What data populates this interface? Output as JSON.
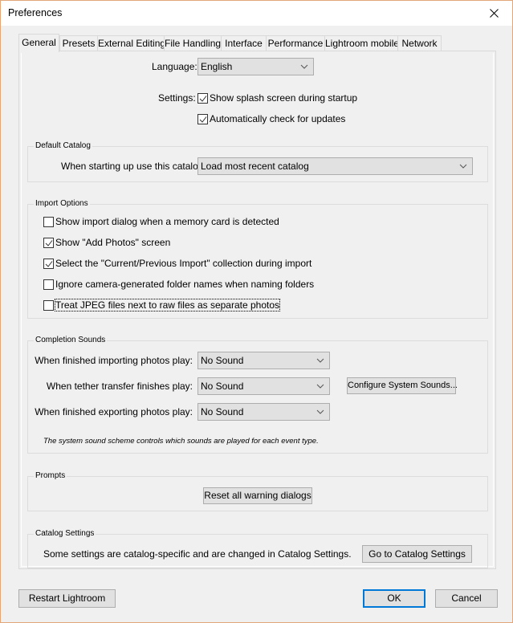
{
  "window": {
    "title": "Preferences",
    "close_icon": "close-icon"
  },
  "tabs": [
    {
      "label": "General",
      "active": true
    },
    {
      "label": "Presets",
      "active": false
    },
    {
      "label": "External Editing",
      "active": false
    },
    {
      "label": "File Handling",
      "active": false
    },
    {
      "label": "Interface",
      "active": false
    },
    {
      "label": "Performance",
      "active": false
    },
    {
      "label": "Lightroom mobile",
      "active": false
    },
    {
      "label": "Network",
      "active": false
    }
  ],
  "general": {
    "language_label": "Language:",
    "language_value": "English",
    "settings_label": "Settings:",
    "settings_options": [
      {
        "label": "Show splash screen during startup",
        "checked": true
      },
      {
        "label": "Automatically check for updates",
        "checked": true
      }
    ]
  },
  "default_catalog": {
    "title": "Default Catalog",
    "label": "When starting up use this catalog:",
    "value": "Load most recent catalog"
  },
  "import_options": {
    "title": "Import Options",
    "items": [
      {
        "label": "Show import dialog when a memory card is detected",
        "checked": false
      },
      {
        "label": "Show \"Add Photos\" screen",
        "checked": true
      },
      {
        "label": "Select the \"Current/Previous Import\" collection during import",
        "checked": true
      },
      {
        "label": "Ignore camera-generated folder names when naming folders",
        "checked": false
      },
      {
        "label": "Treat JPEG files next to raw files as separate photos",
        "checked": false,
        "focused": true
      }
    ]
  },
  "completion_sounds": {
    "title": "Completion Sounds",
    "rows": [
      {
        "label": "When finished importing photos play:",
        "value": "No Sound"
      },
      {
        "label": "When tether transfer finishes play:",
        "value": "No Sound"
      },
      {
        "label": "When finished exporting photos play:",
        "value": "No Sound"
      }
    ],
    "configure_button": "Configure System Sounds...",
    "note": "The system sound scheme controls which sounds are played for each event type."
  },
  "prompts": {
    "title": "Prompts",
    "reset_button": "Reset all warning dialogs"
  },
  "catalog_settings": {
    "title": "Catalog Settings",
    "text": "Some settings are catalog-specific and are changed in Catalog Settings.",
    "button": "Go to Catalog Settings"
  },
  "footer": {
    "restart_button": "Restart Lightroom",
    "ok_button": "OK",
    "cancel_button": "Cancel"
  },
  "colors": {
    "accent": "#0078d7",
    "window_border": "#e2a67b",
    "background": "#f0f0f0"
  }
}
